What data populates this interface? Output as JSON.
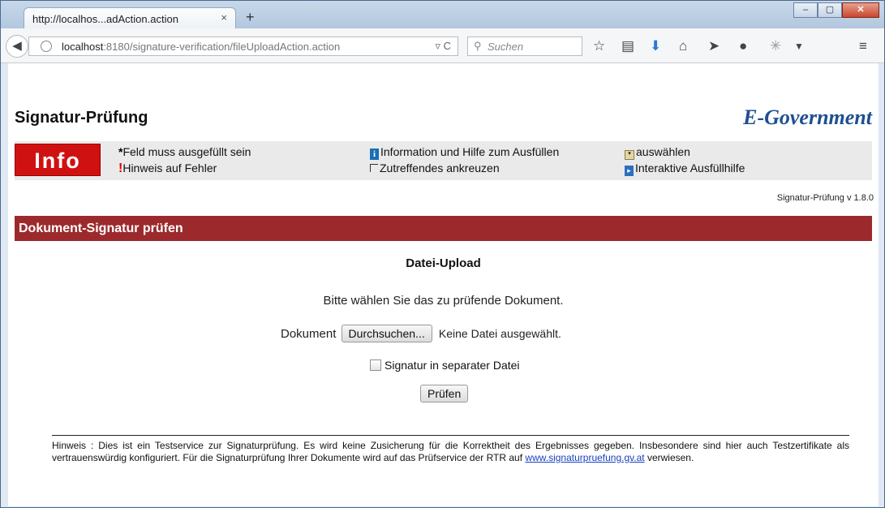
{
  "browser": {
    "tab_title": "http://localhos...adAction.action",
    "tab_close": "×",
    "new_tab": "+",
    "url_host": "localhost",
    "url_rest": ":8180/signature-verification/fileUploadAction.action",
    "search_placeholder": "Suchen"
  },
  "page": {
    "site_title": "Signatur-Prüfung",
    "brand": "E-Government",
    "info_label": "Info",
    "legend": {
      "required": "Feld muss ausgefüllt sein",
      "error": "Hinweis auf Fehler",
      "info_help": "Information und Hilfe zum Ausfüllen",
      "check": "Zutreffendes ankreuzen",
      "select": "auswählen",
      "interactive": "Interaktive Ausfüllhilfe"
    },
    "version": "Signatur-Prüfung v 1.8.0",
    "section_title": "Dokument-Signatur prüfen",
    "upload_title": "Datei-Upload",
    "instruction": "Bitte wählen Sie das zu prüfende Dokument.",
    "document_label": "Dokument",
    "browse_button": "Durchsuchen...",
    "no_file": "Keine Datei ausgewählt.",
    "separate_signature": "Signatur in separater Datei",
    "check_button": "Prüfen",
    "notice_text": "Hinweis : Dies ist ein Testservice zur Signaturprüfung. Es wird keine Zusicherung für die Korrektheit des Ergebnisses gegeben. Insbesondere sind hier auch Testzertifikate als vertrauenswürdig konfiguriert. Für die Signaturprüfung Ihrer Dokumente wird auf das Prüfservice der RTR auf",
    "notice_link": "www.signaturpruefung.gv.at",
    "notice_end": "verwiesen."
  },
  "colors": {
    "section_bar": "#9c2a2d",
    "info_box": "#d01111",
    "brand": "#1e4f8f"
  }
}
